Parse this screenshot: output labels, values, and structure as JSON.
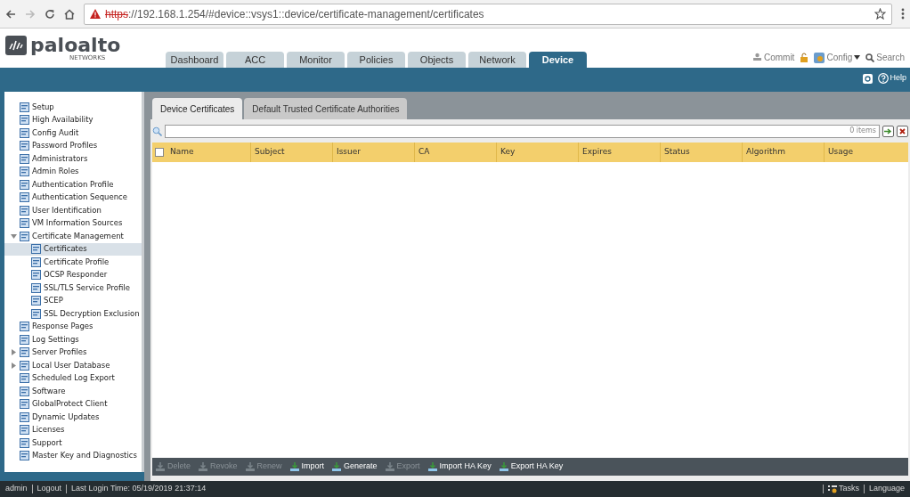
{
  "browser": {
    "url_scheme": "https",
    "url_rest": "://192.168.1.254/#device::vsys1::device/certificate-management/certificates"
  },
  "logo": {
    "name": "paloalto",
    "sub": "NETWORKS"
  },
  "tabs": [
    {
      "label": "Dashboard",
      "selected": false
    },
    {
      "label": "ACC",
      "selected": false
    },
    {
      "label": "Monitor",
      "selected": false
    },
    {
      "label": "Policies",
      "selected": false
    },
    {
      "label": "Objects",
      "selected": false
    },
    {
      "label": "Network",
      "selected": false
    },
    {
      "label": "Device",
      "selected": true
    }
  ],
  "header_actions": {
    "commit": "Commit",
    "config": "Config",
    "search": "Search",
    "help": "Help"
  },
  "sidebar": {
    "items": [
      {
        "label": "Setup",
        "selected": false
      },
      {
        "label": "High Availability",
        "selected": false
      },
      {
        "label": "Config Audit",
        "selected": false
      },
      {
        "label": "Password Profiles",
        "selected": false
      },
      {
        "label": "Administrators",
        "selected": false
      },
      {
        "label": "Admin Roles",
        "selected": false
      },
      {
        "label": "Authentication Profile",
        "selected": false
      },
      {
        "label": "Authentication Sequence",
        "selected": false
      },
      {
        "label": "User Identification",
        "selected": false
      },
      {
        "label": "VM Information Sources",
        "selected": false
      },
      {
        "label": "Certificate Management",
        "selected": false,
        "expanded": true,
        "children": [
          {
            "label": "Certificates",
            "selected": true
          },
          {
            "label": "Certificate Profile",
            "selected": false
          },
          {
            "label": "OCSP Responder",
            "selected": false
          },
          {
            "label": "SSL/TLS Service Profile",
            "selected": false
          },
          {
            "label": "SCEP",
            "selected": false
          },
          {
            "label": "SSL Decryption Exclusion",
            "selected": false
          }
        ]
      },
      {
        "label": "Response Pages",
        "selected": false
      },
      {
        "label": "Log Settings",
        "selected": false
      },
      {
        "label": "Server Profiles",
        "selected": false,
        "expanded": false
      },
      {
        "label": "Local User Database",
        "selected": false,
        "expanded": false
      },
      {
        "label": "Scheduled Log Export",
        "selected": false
      },
      {
        "label": "Software",
        "selected": false
      },
      {
        "label": "GlobalProtect Client",
        "selected": false
      },
      {
        "label": "Dynamic Updates",
        "selected": false
      },
      {
        "label": "Licenses",
        "selected": false
      },
      {
        "label": "Support",
        "selected": false
      },
      {
        "label": "Master Key and Diagnostics",
        "selected": false
      }
    ]
  },
  "subtabs": [
    {
      "label": "Device Certificates",
      "selected": true
    },
    {
      "label": "Default Trusted Certificate Authorities",
      "selected": false
    }
  ],
  "filter": {
    "count": "0 items"
  },
  "table": {
    "columns": [
      "Name",
      "Subject",
      "Issuer",
      "CA",
      "Key",
      "Expires",
      "Status",
      "Algorithm",
      "Usage"
    ],
    "select_all": false
  },
  "toolbar": [
    {
      "label": "Delete",
      "disabled": true
    },
    {
      "label": "Revoke",
      "disabled": true
    },
    {
      "label": "Renew",
      "disabled": true
    },
    {
      "label": "Import",
      "disabled": false
    },
    {
      "label": "Generate",
      "disabled": false
    },
    {
      "label": "Export",
      "disabled": true
    },
    {
      "label": "Import HA Key",
      "disabled": false
    },
    {
      "label": "Export HA Key",
      "disabled": false
    }
  ],
  "status_bar": {
    "user": "admin",
    "logout": "Logout",
    "last_login": "Last Login Time: 05/19/2019 21:37:14",
    "tasks": "Tasks",
    "language": "Language"
  }
}
